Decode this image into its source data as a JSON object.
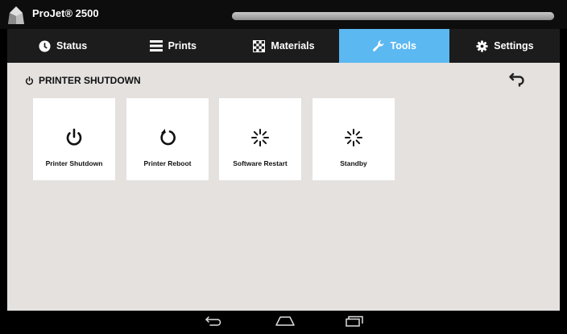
{
  "app": {
    "title": "ProJet® 2500",
    "progress_fraction": 1.0
  },
  "tabs": [
    {
      "label": "Status",
      "icon": "clock-icon",
      "active": false
    },
    {
      "label": "Prints",
      "icon": "list-icon",
      "active": false
    },
    {
      "label": "Materials",
      "icon": "checkerboard-icon",
      "active": false
    },
    {
      "label": "Tools",
      "icon": "wrench-icon",
      "active": true
    },
    {
      "label": "Settings",
      "icon": "gear-icon",
      "active": false
    }
  ],
  "page": {
    "title": "PRINTER SHUTDOWN",
    "title_icon": "power-icon",
    "back_icon": "back-arrow-icon"
  },
  "tiles": [
    {
      "label": "Printer Shutdown",
      "icon": "power-icon"
    },
    {
      "label": "Printer Reboot",
      "icon": "reboot-icon"
    },
    {
      "label": "Software Restart",
      "icon": "spinner-icon"
    },
    {
      "label": "Standby",
      "icon": "spinner-icon"
    }
  ],
  "navbar": {
    "buttons": [
      "back-icon",
      "home-icon",
      "recent-apps-icon"
    ]
  },
  "colors": {
    "active_tab": "#5bb8f1",
    "tab_bar": "#1c1c1c",
    "content_bg": "#e4e1df",
    "title_bar": "#0d0d0d"
  }
}
